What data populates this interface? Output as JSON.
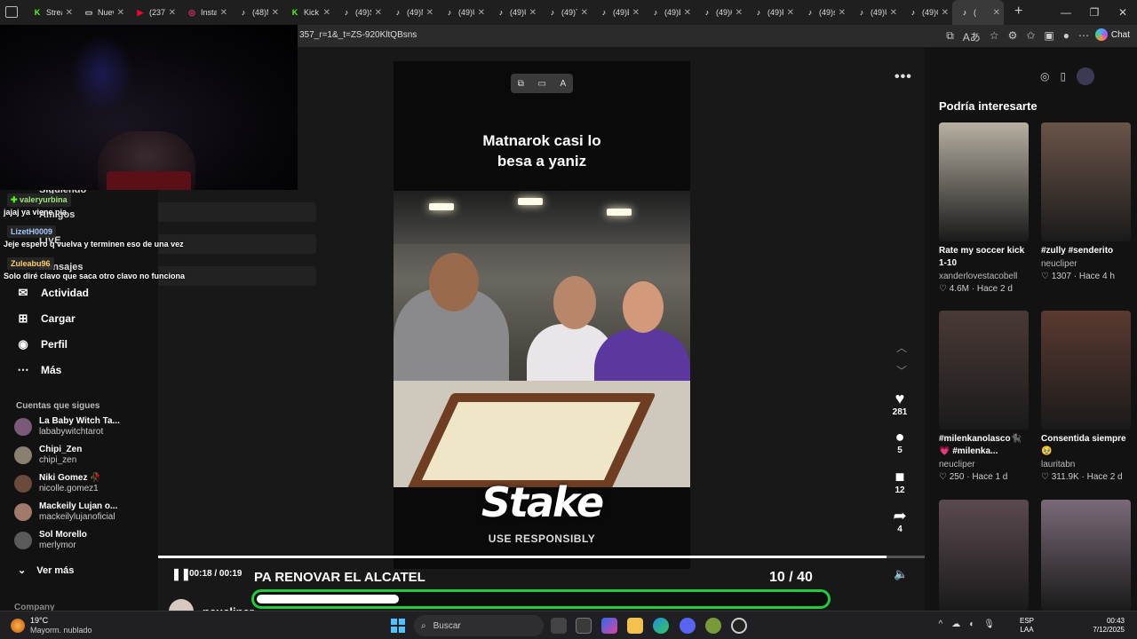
{
  "browser": {
    "tabs": [
      {
        "label": "Strea",
        "fav": "K",
        "color": "#53fc18"
      },
      {
        "label": "Nuev",
        "fav": "▭",
        "color": "#ddd"
      },
      {
        "label": "(237)",
        "fav": "▶",
        "color": "#ff0033"
      },
      {
        "label": "Instag",
        "fav": "◎",
        "color": "#e1306c"
      },
      {
        "label": "(48)M",
        "fav": "♪",
        "color": "#fff"
      },
      {
        "label": "Kick",
        "fav": "K",
        "color": "#53fc18"
      },
      {
        "label": "(49)Sl",
        "fav": "♪",
        "color": "#fff"
      },
      {
        "label": "(49)N",
        "fav": "♪",
        "color": "#fff"
      },
      {
        "label": "(49)U",
        "fav": "♪",
        "color": "#fff"
      },
      {
        "label": "(49)U",
        "fav": "♪",
        "color": "#fff"
      },
      {
        "label": "(49)Ta",
        "fav": "♪",
        "color": "#fff"
      },
      {
        "label": "(49)E",
        "fav": "♪",
        "color": "#fff"
      },
      {
        "label": "(49)B",
        "fav": "♪",
        "color": "#fff"
      },
      {
        "label": "(49)#",
        "fav": "♪",
        "color": "#fff"
      },
      {
        "label": "(49)F",
        "fav": "♪",
        "color": "#fff"
      },
      {
        "label": "(49)sc",
        "fav": "♪",
        "color": "#fff"
      },
      {
        "label": "(49)U",
        "fav": "♪",
        "color": "#fff"
      },
      {
        "label": "(49)C",
        "fav": "♪",
        "color": "#fff"
      },
      {
        "label": "(",
        "fav": "♪",
        "color": "#fff"
      }
    ],
    "url": "357_r=1&_t=ZS-920KltQBsns",
    "chat_label": "Chat"
  },
  "stream_chat": [
    {
      "user": "valeryurbina",
      "user_color": "#9fe87a",
      "msg": "jajaj ya viene pia"
    },
    {
      "user": "LizetH0009",
      "user_color": "#a8c8ff",
      "msg": "Jeje espero q vuelva y terminen eso de una vez"
    },
    {
      "user": "Zuleabu96",
      "user_color": "#ffcf6a",
      "msg": "Solo diré clavo que saca otro clavo no funciona"
    }
  ],
  "sidebar": {
    "hidden_items": [
      "Siguiendo",
      "Amigos",
      "LIVE",
      "Mensajes"
    ],
    "nav": [
      {
        "label": "Actividad",
        "icon": "inbox-icon",
        "glyph": "✉"
      },
      {
        "label": "Cargar",
        "icon": "upload-icon",
        "glyph": "⊞"
      },
      {
        "label": "Perfil",
        "icon": "profile-icon",
        "glyph": "◉"
      },
      {
        "label": "Más",
        "icon": "more-icon",
        "glyph": "⋯"
      }
    ],
    "following_title": "Cuentas que sigues",
    "following": [
      {
        "name": "La Baby Witch Ta...",
        "user": "lababywitchtarot",
        "color": "#7a5a78"
      },
      {
        "name": "Chipi_Zen",
        "user": "chipi_zen",
        "color": "#8a8070"
      },
      {
        "name": "Niki Gomez 🥀",
        "user": "nicolle.gomez1",
        "color": "#6a4a3a"
      },
      {
        "name": "Mackeily Lujan o...",
        "user": "mackeilylujanoficial",
        "color": "#a07a6a"
      },
      {
        "name": "Sol Morello",
        "user": "merlymor",
        "color": "#5a5a5a"
      }
    ],
    "see_more": "Ver más",
    "company": "Company"
  },
  "video": {
    "caption_line1": "Matnarok casi lo",
    "caption_line2": "besa a yaniz",
    "sponsor": "Stake",
    "sponsor_sub": "USE RESPONSIBLY",
    "time": "00:18 / 00:19",
    "progress": 0.95,
    "author": "neucliper"
  },
  "actions": {
    "likes": "281",
    "comments": "5",
    "saves": "12",
    "shares": "4"
  },
  "overlay": {
    "banner": "PA RENOVAR EL ALCATEL",
    "count": "10",
    "total": "/ 40",
    "goal_progress": 0.25
  },
  "recommendations": {
    "title": "Podría interesarte",
    "cards": [
      {
        "title": "Rate my soccer kick 1-10",
        "author": "xanderlovestacobell",
        "likes": "4.6M",
        "age": "Hace 2 d",
        "bg": "#b7b0a2"
      },
      {
        "title": "#zully #senderito",
        "author": "neucliper",
        "likes": "1307",
        "age": "Hace 4 h",
        "bg": "#6a5448"
      },
      {
        "title": "#milenkanolasco🐈‍⬛💗 #milenka...",
        "author": "neucliper",
        "likes": "250",
        "age": "Hace 1 d",
        "bg": "#4a3a36"
      },
      {
        "title": "Consentida siempre 🥹",
        "author": "lauritabn",
        "likes": "311.9K",
        "age": "Hace 2 d",
        "bg": "#5a3a30"
      },
      {
        "title": "",
        "author": "",
        "likes": "",
        "age": "",
        "bg": "#5a4a50"
      },
      {
        "title": "",
        "author": "",
        "likes": "",
        "age": "",
        "bg": "#7a6a78"
      }
    ]
  },
  "taskbar": {
    "temp": "19°C",
    "weather": "Mayorm. nublado",
    "search": "Buscar",
    "lang1": "ESP",
    "lang2": "LAA",
    "time": "00:43",
    "date": "7/12/2025"
  }
}
